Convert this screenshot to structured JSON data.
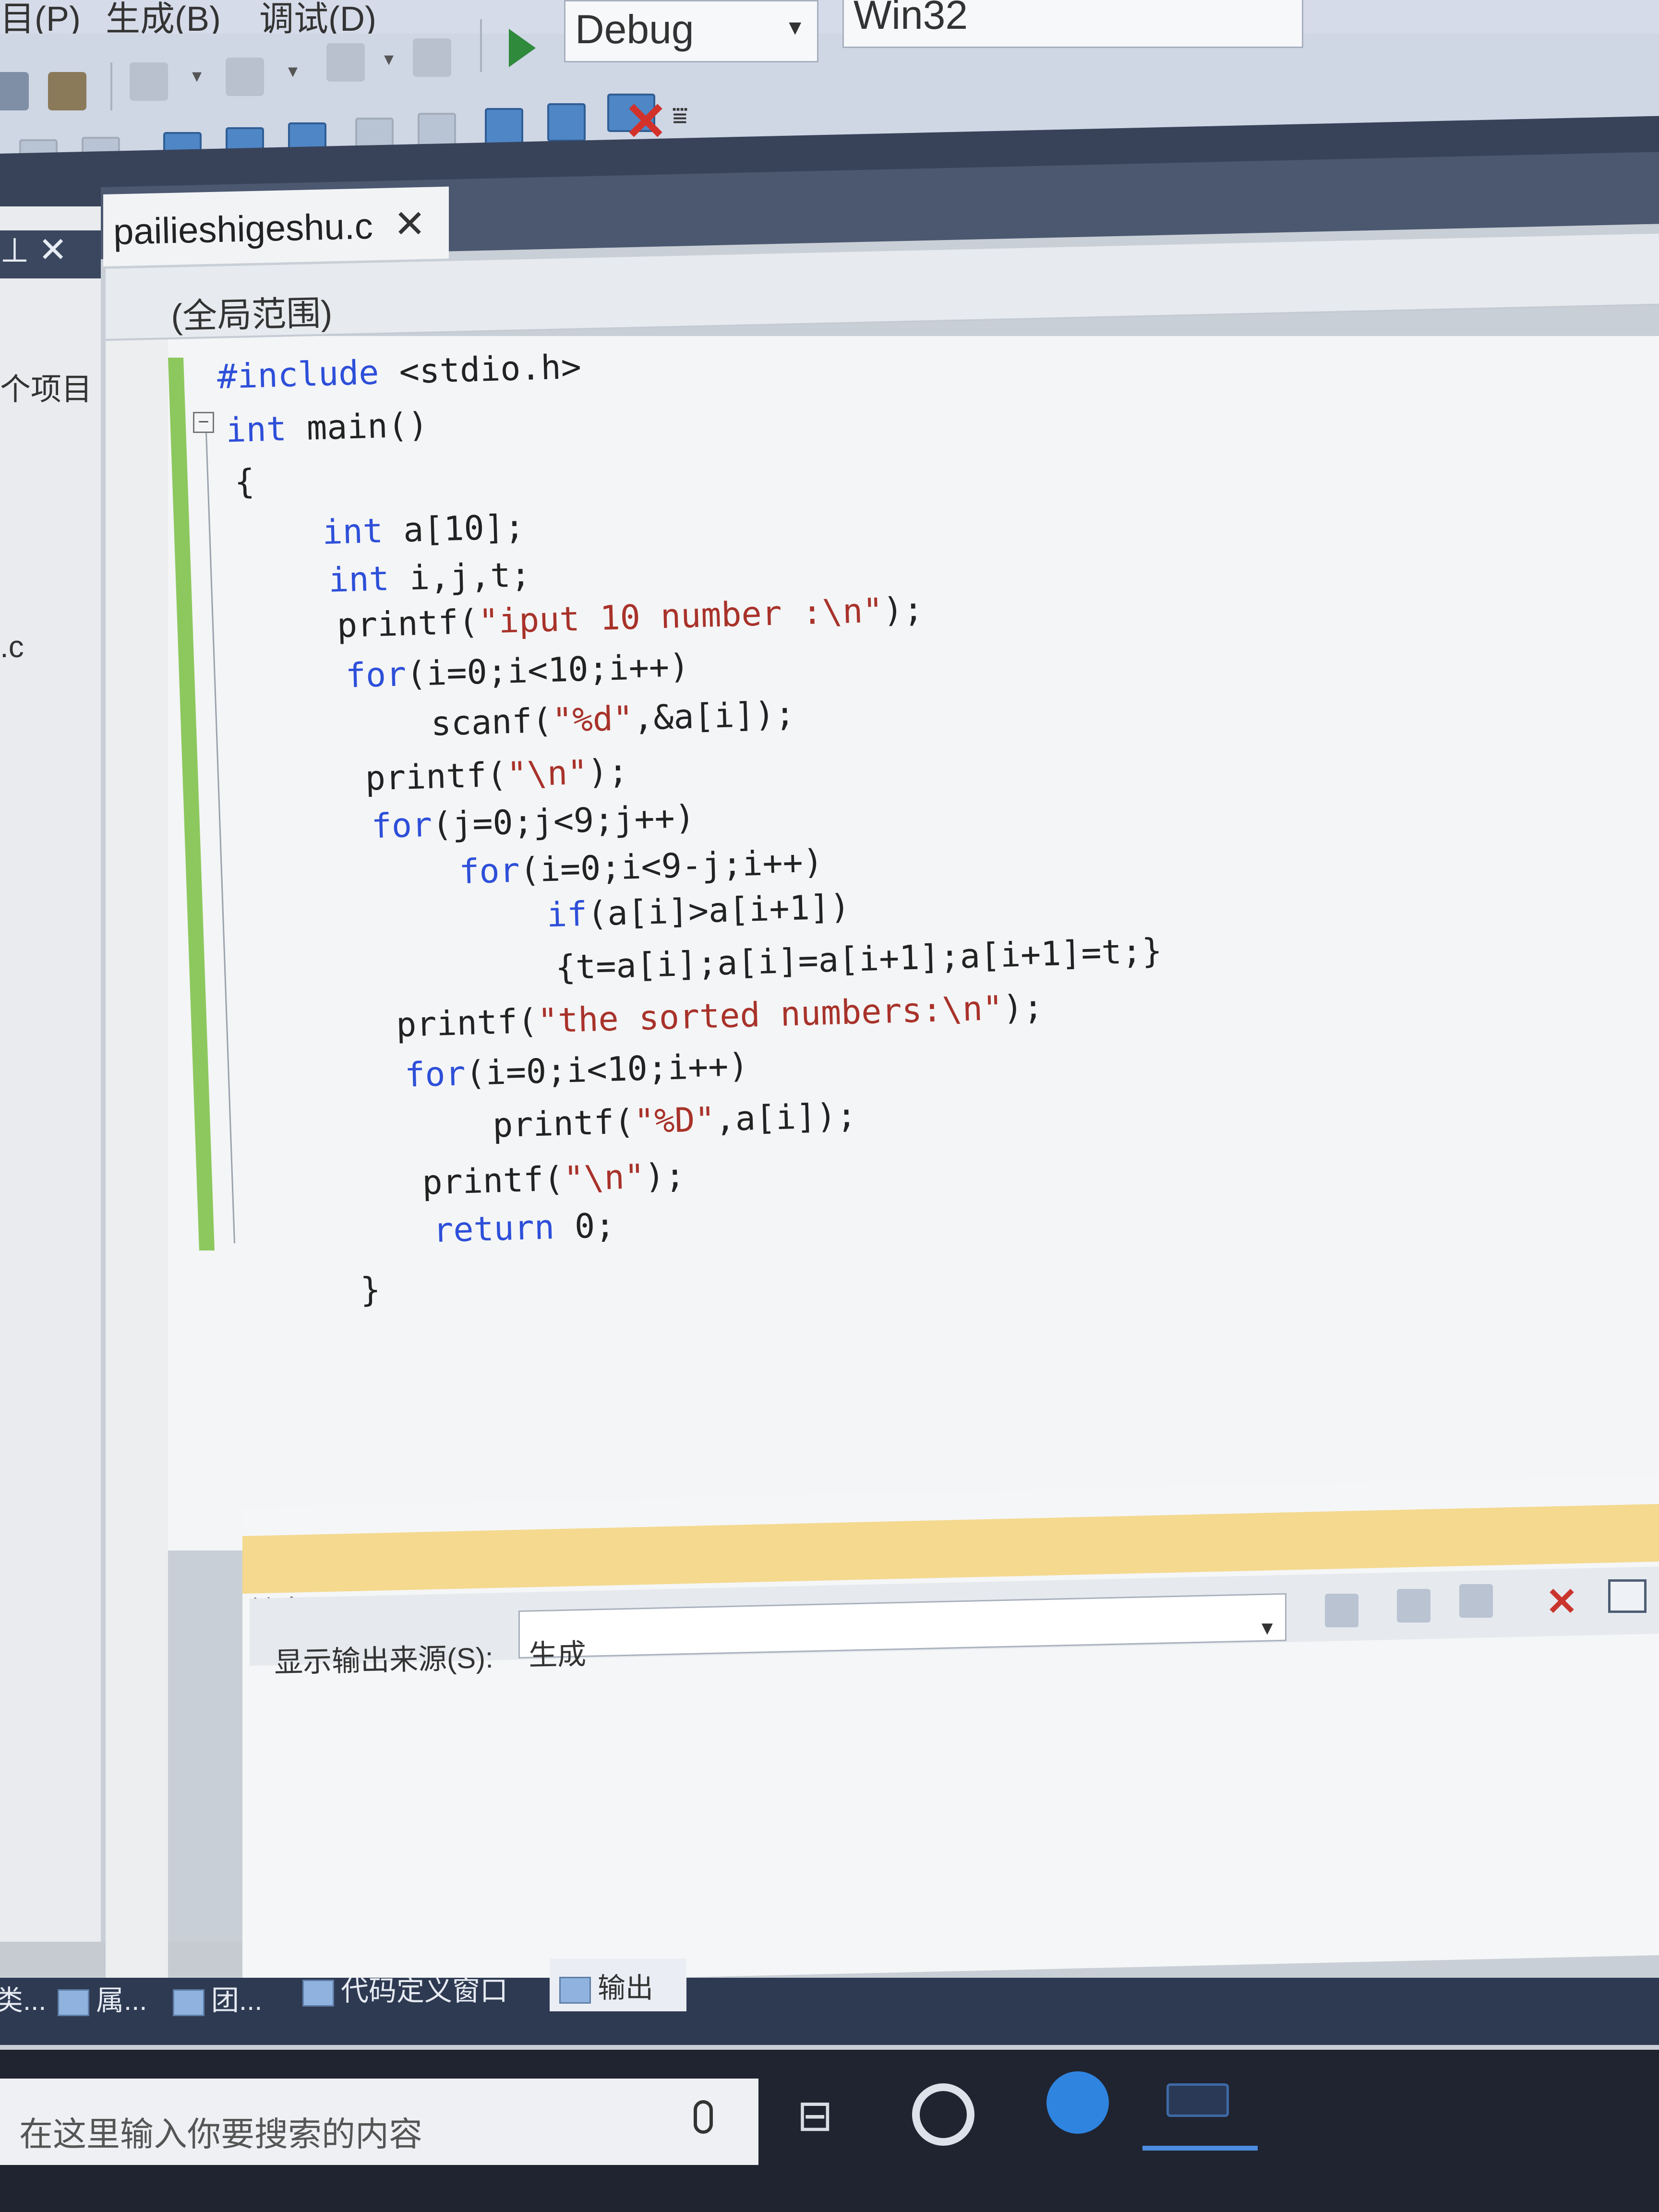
{
  "menubar": {
    "items": [
      "目(P)",
      "生成(B)",
      "调试(D)"
    ]
  },
  "toolbar": {
    "config_value": "Debug",
    "platform_value": "Win32"
  },
  "left_pane": {
    "label": "个项目",
    "file": ".c"
  },
  "editor": {
    "tab_name": "pailieshigeshu.c",
    "scope": "(全局范围)",
    "lines": [
      "#include <stdio.h>",
      "int main()",
      "{",
      "int a[10];",
      "int i,j,t;",
      "printf(\"iput 10 number :\\n\");",
      "for(i=0;i<10;i++)",
      "scanf(\"%d\",&a[i]);",
      "printf(\"\\n\");",
      "for(j=0;j<9;j++)",
      "for(i=0;i<9-j;i++)",
      "if(a[i]>a[i+1])",
      "{t=a[i];a[i]=a[i+1];a[i+1]=t;}",
      "printf(\"the sorted numbers:\\n\");",
      "for(i=0;i<10;i++)",
      "printf(\"%D\",a[i]);",
      "printf(\"\\n\");",
      "return 0;",
      "}"
    ]
  },
  "output": {
    "title": "输出",
    "source_label": "显示输出来源(S):",
    "source_value": "生成"
  },
  "bottom_tabs": [
    "类...",
    "属...",
    "团...",
    "代码定义窗口",
    "输出"
  ],
  "taskbar": {
    "search_placeholder": "在这里输入你要搜索的内容"
  }
}
